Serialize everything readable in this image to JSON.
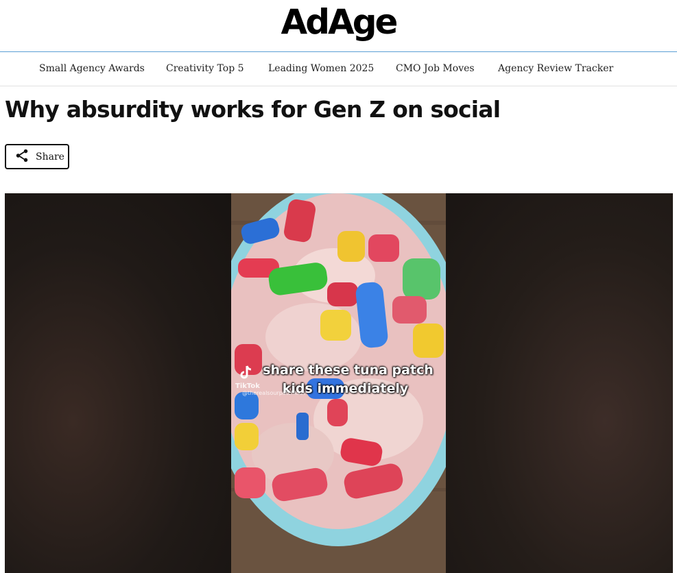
{
  "site": {
    "logo": "AdAge"
  },
  "nav": {
    "items": [
      {
        "label": "Small Agency Awards"
      },
      {
        "label": "Creativity Top 5"
      },
      {
        "label": "Leading Women 2025"
      },
      {
        "label": "CMO Job Moves"
      },
      {
        "label": "Agency Review Tracker"
      }
    ]
  },
  "article": {
    "headline": "Why absurdity works for Gen Z on social",
    "share_label": "Share",
    "share_icon": "share-icon"
  },
  "media": {
    "caption_line1": "share these tuna patch",
    "caption_line2": "kids immediately",
    "watermark": "TikTok",
    "handle": "@therealsourpatchkids"
  },
  "colors": {
    "accent_rule": "#5a9fd4",
    "text": "#111111"
  }
}
